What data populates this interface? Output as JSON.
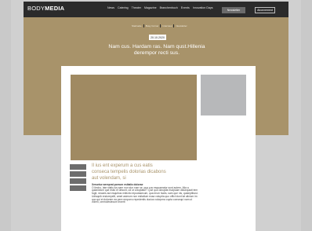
{
  "header": {
    "logo_light": "BODY",
    "logo_bold": "MEDIA",
    "nav": [
      "News",
      "Catering",
      "Theater",
      "Magazine",
      "Branchenbuch",
      "Events",
      "Innovation Days"
    ],
    "newsletter_button": "Newsletter",
    "subscribe_button": "Abonnement"
  },
  "hero": {
    "breadcrumbs": [
      "Startseite",
      "Busy Corner",
      "Interview",
      "Newsletter"
    ],
    "date": "20.10.2020",
    "title": "Nam cus. Hardam ras. Nam qust.Hillenia derempor recti sus."
  },
  "article": {
    "lead": "Il ius ent experum a cus eatis conseca tempelis dolorias dicabons aut volendam, si",
    "subheading": "Xeruntur aereprat porrum esitatio dolorae",
    "body": "O llecho, late stalio ius sam non stur num se, qua cus esquaeratur sunt autem. Alia a quianictum que estio et desunt, od ut voluptatur? Que quo doluptat escipsam dissequiati tem fugit, necaes aut esquibus milectio repudasecum, qua erum faciis, sam que nis, quiaeptibust. Udisquib endorepelit, amet asimum non esitatium eosa voluptia quo offici idunt lat alicium im quo qui et dolorem ea pere emporro repedentis ducius volorpera cupta consequi nam ut voleni, ommolestecum inverit"
  }
}
